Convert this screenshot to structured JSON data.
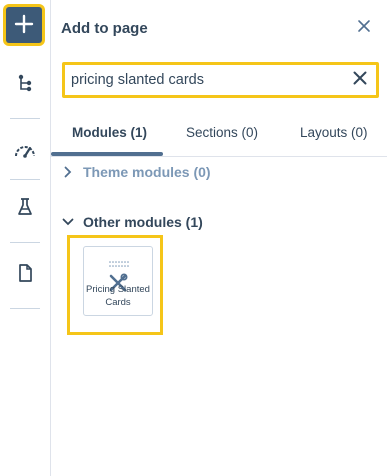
{
  "sidebar": {
    "add_icon": "plus-icon",
    "items": [
      {
        "name": "tree-structure-icon"
      },
      {
        "name": "gauge-icon"
      },
      {
        "name": "flask-icon"
      },
      {
        "name": "page-icon"
      }
    ]
  },
  "panel": {
    "title": "Add to page",
    "search": {
      "value": "pricing slanted cards",
      "placeholder": ""
    },
    "tabs": [
      {
        "label": "Modules (1)",
        "active": true
      },
      {
        "label": "Sections (0)",
        "active": false
      },
      {
        "label": "Layouts (0)",
        "active": false
      }
    ],
    "groups": [
      {
        "label": "Theme modules (0)",
        "expanded": false
      },
      {
        "label": "Other modules (1)",
        "expanded": true
      }
    ],
    "modules": [
      {
        "label": "Pricing Slanted Cards",
        "icon": "tools-icon"
      }
    ]
  },
  "colors": {
    "accent": "#3d5a78",
    "highlight": "#f5c518",
    "text": "#33475b",
    "muted": "#7c98b6"
  }
}
